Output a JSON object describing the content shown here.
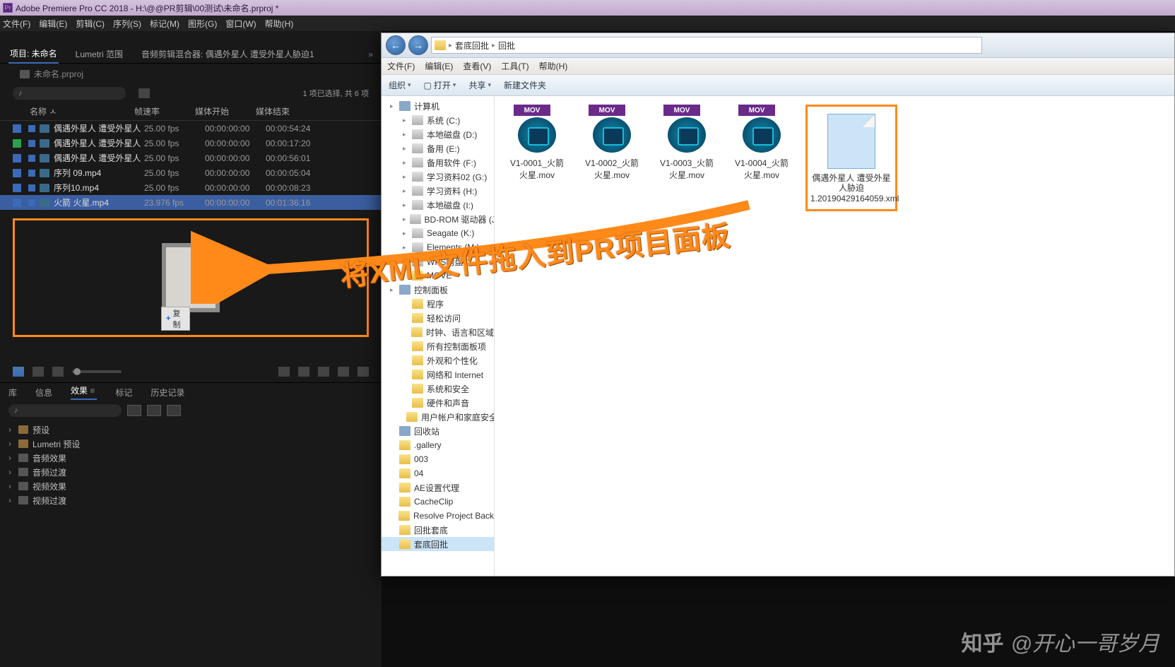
{
  "pr": {
    "title": "Adobe Premiere Pro CC 2018 - H:\\@@PR剪辑\\00测试\\未命名.prproj *",
    "menu": [
      "文件(F)",
      "编辑(E)",
      "剪辑(C)",
      "序列(S)",
      "标记(M)",
      "图形(G)",
      "窗口(W)",
      "帮助(H)"
    ],
    "tabs": {
      "project": "项目: 未命名",
      "lumetri": "Lumetri 范围",
      "mixer": "音频剪辑混合器: 偶遇外星人 遭受外星人胁迫1",
      "arrow": "»"
    },
    "projName": "未命名.prproj",
    "searchPlaceholder": "♪",
    "selInfo": "1 项已选择, 共 6 项",
    "cols": {
      "name": "名称 ㅅ",
      "fps": "帧速率",
      "start": "媒体开始",
      "end": "媒体结束"
    },
    "rows": [
      {
        "swatch": "#3b6ab7",
        "name": "偶遇外星人 遭受外星人",
        "fps": "25.00 fps",
        "start": "00:00:00:00",
        "end": "00:00:54:24"
      },
      {
        "swatch": "#2aa24a",
        "name": "偶遇外星人 遭受外星人",
        "fps": "25.00 fps",
        "start": "00:00:00:00",
        "end": "00:00:17:20"
      },
      {
        "swatch": "#3b6ab7",
        "name": "偶遇外星人 遭受外星人",
        "fps": "25.00 fps",
        "start": "00:00:00:00",
        "end": "00:00:56:01"
      },
      {
        "swatch": "#3b6ab7",
        "name": "序列 09.mp4",
        "fps": "25.00 fps",
        "start": "00:00:00:00",
        "end": "00:00:05:04"
      },
      {
        "swatch": "#3b6ab7",
        "name": "序列10.mp4",
        "fps": "25.00 fps",
        "start": "00:00:00:00",
        "end": "00:00:08:23"
      },
      {
        "swatch": "#3b6ab7",
        "name": "火箭 火星.mp4",
        "fps": "23.976 fps",
        "start": "00:00:00:00",
        "end": "00:01:36:16",
        "sel": true
      }
    ],
    "copyBadge": "复制",
    "fxTabs": {
      "lib": "库",
      "info": "信息",
      "fx": "效果",
      "marker": "标记",
      "history": "历史记录"
    },
    "fxTree": [
      "预设",
      "Lumetri 预设",
      "音频效果",
      "音频过渡",
      "视频效果",
      "视频过渡"
    ]
  },
  "ex": {
    "path": [
      "套底回批",
      "回批"
    ],
    "menu": [
      "文件(F)",
      "编辑(E)",
      "查看(V)",
      "工具(T)",
      "帮助(H)"
    ],
    "toolbar": {
      "org": "组织",
      "open": "打开",
      "share": "共享",
      "new": "新建文件夹"
    },
    "tree": [
      {
        "t": "计算机",
        "ic": "computer",
        "l": 1,
        "chev": "▸"
      },
      {
        "t": "系统 (C:)",
        "ic": "drive",
        "l": 2,
        "chev": "▸"
      },
      {
        "t": "本地磁盘 (D:)",
        "ic": "drive",
        "l": 2,
        "chev": "▸"
      },
      {
        "t": "备用 (E:)",
        "ic": "drive",
        "l": 2,
        "chev": "▸"
      },
      {
        "t": "备用软件 (F:)",
        "ic": "drive",
        "l": 2,
        "chev": "▸"
      },
      {
        "t": "学习资料02 (G:)",
        "ic": "drive",
        "l": 2,
        "chev": "▸"
      },
      {
        "t": "学习资料 (H:)",
        "ic": "drive",
        "l": 2,
        "chev": "▸"
      },
      {
        "t": "本地磁盘 (I:)",
        "ic": "drive",
        "l": 2,
        "chev": "▸"
      },
      {
        "t": "BD-ROM 驱动器 (J:)",
        "ic": "drive",
        "l": 2,
        "chev": "▸"
      },
      {
        "t": "Seagate (K:)",
        "ic": "drive",
        "l": 2,
        "chev": "▸"
      },
      {
        "t": "Elements (M:)",
        "ic": "drive",
        "l": 2,
        "chev": "▸"
      },
      {
        "t": "WPS网盘",
        "ic": "drive",
        "l": 2,
        "chev": "▸"
      },
      {
        "t": "MOVE",
        "ic": "folder",
        "l": 2,
        "chev": ""
      },
      {
        "t": "控制面板",
        "ic": "computer",
        "l": 1,
        "chev": "▸"
      },
      {
        "t": "程序",
        "ic": "folder",
        "l": 2,
        "chev": ""
      },
      {
        "t": "轻松访问",
        "ic": "folder",
        "l": 2,
        "chev": ""
      },
      {
        "t": "时钟、语言和区域",
        "ic": "folder",
        "l": 2,
        "chev": ""
      },
      {
        "t": "所有控制面板项",
        "ic": "folder",
        "l": 2,
        "chev": ""
      },
      {
        "t": "外观和个性化",
        "ic": "folder",
        "l": 2,
        "chev": ""
      },
      {
        "t": "网络和 Internet",
        "ic": "folder",
        "l": 2,
        "chev": ""
      },
      {
        "t": "系统和安全",
        "ic": "folder",
        "l": 2,
        "chev": ""
      },
      {
        "t": "硬件和声音",
        "ic": "folder",
        "l": 2,
        "chev": ""
      },
      {
        "t": "用户帐户和家庭安全",
        "ic": "folder",
        "l": 2,
        "chev": ""
      },
      {
        "t": "回收站",
        "ic": "computer",
        "l": 1,
        "chev": ""
      },
      {
        "t": ".gallery",
        "ic": "folder",
        "l": 1,
        "chev": ""
      },
      {
        "t": "003",
        "ic": "folder",
        "l": 1,
        "chev": ""
      },
      {
        "t": "04",
        "ic": "folder",
        "l": 1,
        "chev": ""
      },
      {
        "t": "AE设置代理",
        "ic": "folder",
        "l": 1,
        "chev": ""
      },
      {
        "t": "CacheClip",
        "ic": "folder",
        "l": 1,
        "chev": ""
      },
      {
        "t": "Resolve Project Back",
        "ic": "folder",
        "l": 1,
        "chev": ""
      },
      {
        "t": "回批套底",
        "ic": "folder",
        "l": 1,
        "chev": ""
      },
      {
        "t": "套底回批",
        "ic": "folder",
        "l": 1,
        "chev": "",
        "sel": true
      }
    ],
    "files": [
      {
        "name": "V1-0001_火箭 火星.mov"
      },
      {
        "name": "V1-0002_火箭 火星.mov"
      },
      {
        "name": "V1-0003_火箭 火星.mov"
      },
      {
        "name": "V1-0004_火箭 火星.mov"
      }
    ],
    "xmlFile": "偶遇外星人 遭受外星人胁迫1.20190429164059.xml"
  },
  "annotation": "将XML文件拖入到PR项目面板",
  "watermark": {
    "brand": "知乎",
    "author": "@开心一哥岁月"
  }
}
